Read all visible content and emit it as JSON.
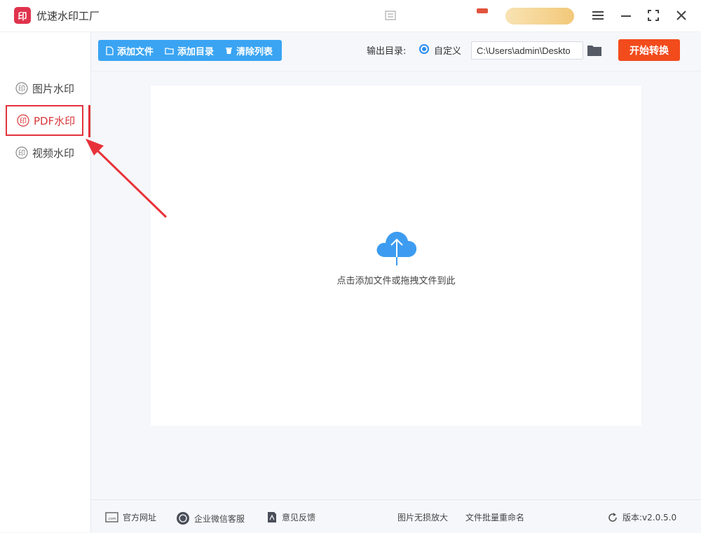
{
  "app": {
    "title": "优速水印工厂",
    "logo_text": "印"
  },
  "sidebar": {
    "items": [
      {
        "label": "图片水印",
        "active": false
      },
      {
        "label": "PDF水印",
        "active": true
      },
      {
        "label": "视频水印",
        "active": false
      }
    ]
  },
  "toolbar": {
    "add_file": "添加文件",
    "add_folder": "添加目录",
    "clear_list": "清除列表",
    "output_label": "输出目录:",
    "output_option": "自定义",
    "output_path": "C:\\Users\\admin\\Deskto",
    "start": "开始转换"
  },
  "drop_area": {
    "text": "点击添加文件或拖拽文件到此"
  },
  "footer": {
    "website": "官方网址",
    "wechat_service": "企业微信客服",
    "feedback": "意见反馈",
    "image_enlarge": "图片无损放大",
    "batch_rename": "文件批量重命名",
    "version": "版本:v2.0.5.0"
  },
  "colors": {
    "accent_blue": "#3aa4f3",
    "start_button": "#f24b1c",
    "active_red": "#e2343d",
    "logo_red": "#e0334d"
  },
  "icons": {
    "logo": "seal-icon",
    "window": [
      "menu-icon",
      "minimize-icon",
      "maximize-icon",
      "close-icon"
    ],
    "nav": "seal-outline-icon",
    "toolbar": [
      "file-icon",
      "folder-icon",
      "trash-icon"
    ],
    "drop": "cloud-upload-icon",
    "footer": [
      "web-icon",
      "chat-icon",
      "feedback-icon",
      "refresh-icon"
    ]
  }
}
